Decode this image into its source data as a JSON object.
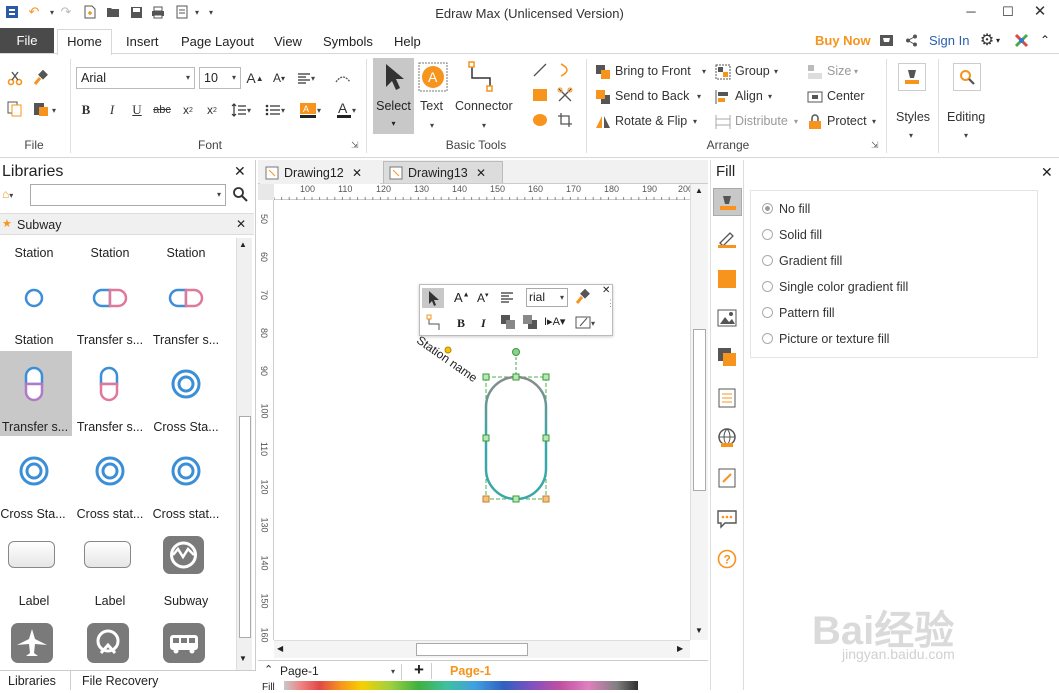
{
  "window": {
    "title": "Edraw Max (Unlicensed Version)",
    "buy_now": "Buy Now",
    "sign_in": "Sign In"
  },
  "menu": {
    "file": "File",
    "tabs": [
      "Home",
      "Insert",
      "Page Layout",
      "View",
      "Symbols",
      "Help"
    ]
  },
  "ribbon": {
    "groups": {
      "file": "File",
      "font": "Font",
      "basic_tools": "Basic Tools",
      "arrange": "Arrange"
    },
    "font_name": "Arial",
    "font_size": "10",
    "select": "Select",
    "text": "Text",
    "connector": "Connector",
    "bring_to_front": "Bring to Front",
    "send_to_back": "Send to Back",
    "rotate_flip": "Rotate & Flip",
    "group": "Group",
    "align": "Align",
    "distribute": "Distribute",
    "size": "Size",
    "center": "Center",
    "protect": "Protect",
    "styles": "Styles",
    "editing": "Editing",
    "text_glyph": "A"
  },
  "libraries": {
    "title": "Libraries",
    "category": "Subway",
    "rows": [
      [
        "Station",
        "Station",
        "Station"
      ],
      [
        "Station",
        "Transfer s...",
        "Transfer s..."
      ],
      [
        "Transfer s...",
        "Transfer s...",
        "Cross Sta..."
      ],
      [
        "Cross Sta...",
        "Cross stat...",
        "Cross stat..."
      ],
      [
        "Label",
        "Label",
        "Subway"
      ]
    ],
    "bottom_tabs": [
      "Libraries",
      "File Recovery"
    ]
  },
  "canvas": {
    "tabs": [
      "Drawing12",
      "Drawing13"
    ],
    "hruler": [
      "100",
      "110",
      "120",
      "130",
      "140",
      "150",
      "160",
      "170",
      "180",
      "190",
      "200"
    ],
    "vruler": [
      "50",
      "60",
      "70",
      "80",
      "90",
      "100",
      "110",
      "120",
      "130",
      "140",
      "150",
      "160"
    ],
    "shape_label": "Station name",
    "toolbar_font": "rial",
    "page_select": "Page-1",
    "page_tab": "Page-1",
    "fill_label": "Fill"
  },
  "fill_panel": {
    "title": "Fill",
    "options": [
      "No fill",
      "Solid fill",
      "Gradient fill",
      "Single color gradient fill",
      "Pattern fill",
      "Picture or texture fill"
    ],
    "selected": 0
  },
  "colors": {
    "accent_orange": "#f7941d",
    "station_blue": "#3c8fd6",
    "station_pink": "#e0789a",
    "shape_teal": "#3aa8a8",
    "selected_bg": "#c8c8c8"
  },
  "watermark": {
    "main": "Bai经验",
    "sub": "jingyan.baidu.com"
  }
}
